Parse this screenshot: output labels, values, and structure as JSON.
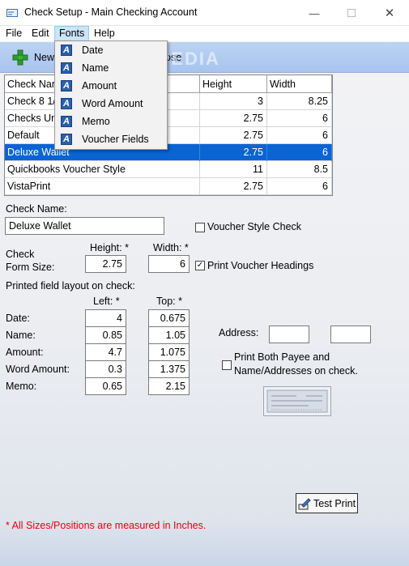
{
  "window": {
    "title": "Check Setup - Main Checking Account"
  },
  "menubar": {
    "file": "File",
    "edit": "Edit",
    "fonts": "Fonts",
    "help": "Help"
  },
  "toolbar": {
    "new_label": "New",
    "close_label": "ose"
  },
  "fonts_menu": [
    "Date",
    "Name",
    "Amount",
    "Word Amount",
    "Memo",
    "Voucher Fields"
  ],
  "table": {
    "headers": [
      "Check Nar",
      "Height",
      "Width"
    ],
    "rows": [
      {
        "name": "Check 8 1/",
        "height": "3",
        "width": "8.25"
      },
      {
        "name": "Checks Un",
        "height": "2.75",
        "width": "6"
      },
      {
        "name": "Default",
        "height": "2.75",
        "width": "6"
      },
      {
        "name": "Deluxe Wallet",
        "height": "2.75",
        "width": "6",
        "selected": true
      },
      {
        "name": "Quickbooks Voucher Style",
        "height": "11",
        "width": "8.5"
      },
      {
        "name": "VistaPrint",
        "height": "2.75",
        "width": "6"
      }
    ]
  },
  "form": {
    "check_name_label": "Check Name:",
    "check_name_value": "Deluxe Wallet",
    "voucher_style_label": "Voucher Style Check",
    "voucher_style_checked": false,
    "check_form_size_label_1": "Check",
    "check_form_size_label_2": "Form Size:",
    "height_label": "Height: *",
    "width_label": "Width: *",
    "height_value": "2.75",
    "width_value": "6",
    "print_voucher_label": "Print Voucher Headings",
    "print_voucher_checked": true,
    "layout_label": "Printed field layout on check:",
    "left_label": "Left: *",
    "top_label": "Top: *",
    "fields": [
      {
        "label": "Date:",
        "left": "4",
        "top": "0.675"
      },
      {
        "label": "Name:",
        "left": "0.85",
        "top": "1.05"
      },
      {
        "label": "Amount:",
        "left": "4.7",
        "top": "1.075"
      },
      {
        "label": "Word Amount:",
        "left": "0.3",
        "top": "1.375"
      },
      {
        "label": "Memo:",
        "left": "0.65",
        "top": "2.15"
      }
    ],
    "address_label": "Address:",
    "address_value_1": "",
    "address_value_2": "",
    "print_both_label_1": "Print Both Payee and",
    "print_both_label_2": "Name/Addresses on check.",
    "print_both_checked": false,
    "test_print_label": "Test Print",
    "footnote": "* All Sizes/Positions are measured in Inches.",
    "footnote_color": "#e8000b"
  },
  "watermark": "SOFTPEDIA"
}
